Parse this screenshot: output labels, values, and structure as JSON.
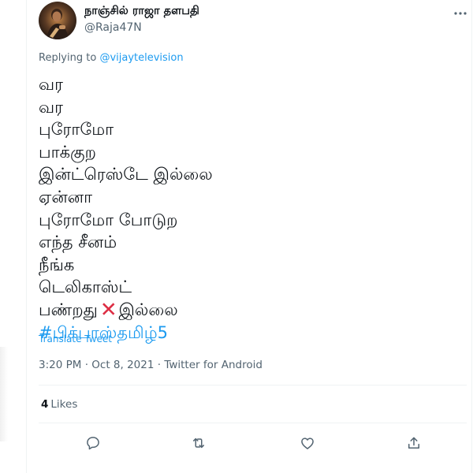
{
  "author": {
    "display_name": "நாஞ்சில் ராஜா தளபதி",
    "handle": "@Raja47N"
  },
  "reply": {
    "prefix": "Replying to ",
    "mention": "@vijaytelevision"
  },
  "tweet": {
    "lines": [
      "வர",
      "வர",
      "புரோமோ",
      "பாக்குற",
      "இன்ட்ரெஸ்டே இல்லை",
      "ஏன்னா",
      "புரோமோ போடுற",
      "எந்த சீனம்",
      "நீங்க",
      "டெலிகாஸ்ட்"
    ],
    "emoji_line_before": "பண்றது",
    "emoji_symbol": "✕",
    "emoji_line_after": "இல்லை",
    "hashtag": "#பிக்பாஸ்தமிழ்5"
  },
  "translate_label": "Translate Tweet",
  "meta": {
    "time": "3:20 PM",
    "date": "Oct 8, 2021",
    "source": "Twitter for Android",
    "separator": " · "
  },
  "likes": {
    "count": "4",
    "label": "Likes"
  },
  "icons": {
    "more": "more-horizontal-icon",
    "reply": "reply-icon",
    "retweet": "retweet-icon",
    "like": "like-icon",
    "share": "share-icon"
  },
  "colors": {
    "link": "#1d9bf0",
    "secondary_text": "#536471",
    "primary_text": "#0f1419",
    "divider": "#eff3f4",
    "emoji_red": "#dd2e44"
  }
}
